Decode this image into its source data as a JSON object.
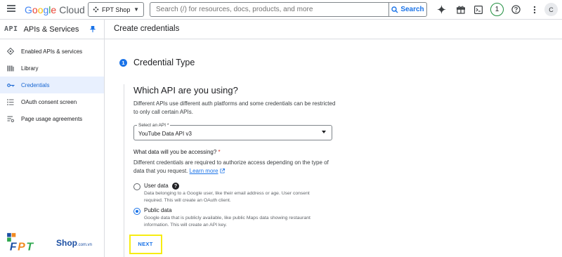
{
  "topbar": {
    "logo_text": "Google",
    "logo_product": "Cloud",
    "project": "FPT Shop",
    "search_placeholder": "Search (/) for resources, docs, products, and more",
    "search_button": "Search",
    "notifications_count": "1",
    "avatar_letter": "C"
  },
  "sidebar": {
    "api_mark": "API",
    "title": "APIs & Services",
    "items": [
      {
        "label": "Enabled APIs & services",
        "icon": "diamond-settings-icon",
        "active": false
      },
      {
        "label": "Library",
        "icon": "library-icon",
        "active": false
      },
      {
        "label": "Credentials",
        "icon": "key-icon",
        "active": true
      },
      {
        "label": "OAuth consent screen",
        "icon": "consent-icon",
        "active": false
      },
      {
        "label": "Page usage agreements",
        "icon": "settings-list-icon",
        "active": false
      }
    ]
  },
  "main": {
    "page_title": "Create credentials",
    "step_number": "1",
    "step_title": "Credential Type",
    "question": "Which API are you using?",
    "question_desc": "Different APIs use different auth platforms and some credentials can be restricted to only call certain APIs.",
    "select_label": "Select an API *",
    "select_value": "YouTube Data API v3",
    "access_question": "What data will you be accessing?",
    "access_required": "*",
    "access_desc": "Different credentials are required to authorize access depending on the type of data that you request.",
    "learn_more": "Learn more",
    "options": [
      {
        "label": "User data",
        "desc": "Data belonging to a Google user, like their email address or age. User consent required. This will create an OAuth client.",
        "checked": false
      },
      {
        "label": "Public data",
        "desc": "Google data that is publicly available, like public Maps data showing restaurant information. This will create an API key.",
        "checked": true
      }
    ],
    "next_button": "NEXT"
  },
  "watermark": {
    "brand": "FPT",
    "shop": "Shop",
    "domain": ".com.vn"
  },
  "colors": {
    "accent": "#1a73e8",
    "highlight": "#f7ec12",
    "active_bg": "#e8f0fe"
  }
}
